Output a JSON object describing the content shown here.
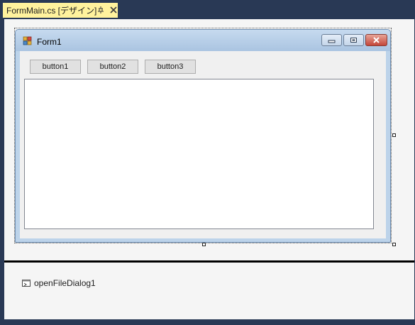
{
  "document_tab": {
    "title": "FormMain.cs [デザイン]"
  },
  "form": {
    "title": "Form1"
  },
  "buttons": [
    {
      "label": "button1"
    },
    {
      "label": "button2"
    },
    {
      "label": "button3"
    }
  ],
  "component_tray": {
    "items": [
      {
        "label": "openFileDialog1",
        "icon": "open-file-dialog-icon"
      }
    ]
  },
  "colors": {
    "ide_background": "#293955",
    "active_tab": "#fff29d",
    "designer_surface": "#f5f5f5",
    "form_client": "#f0f0f0"
  }
}
